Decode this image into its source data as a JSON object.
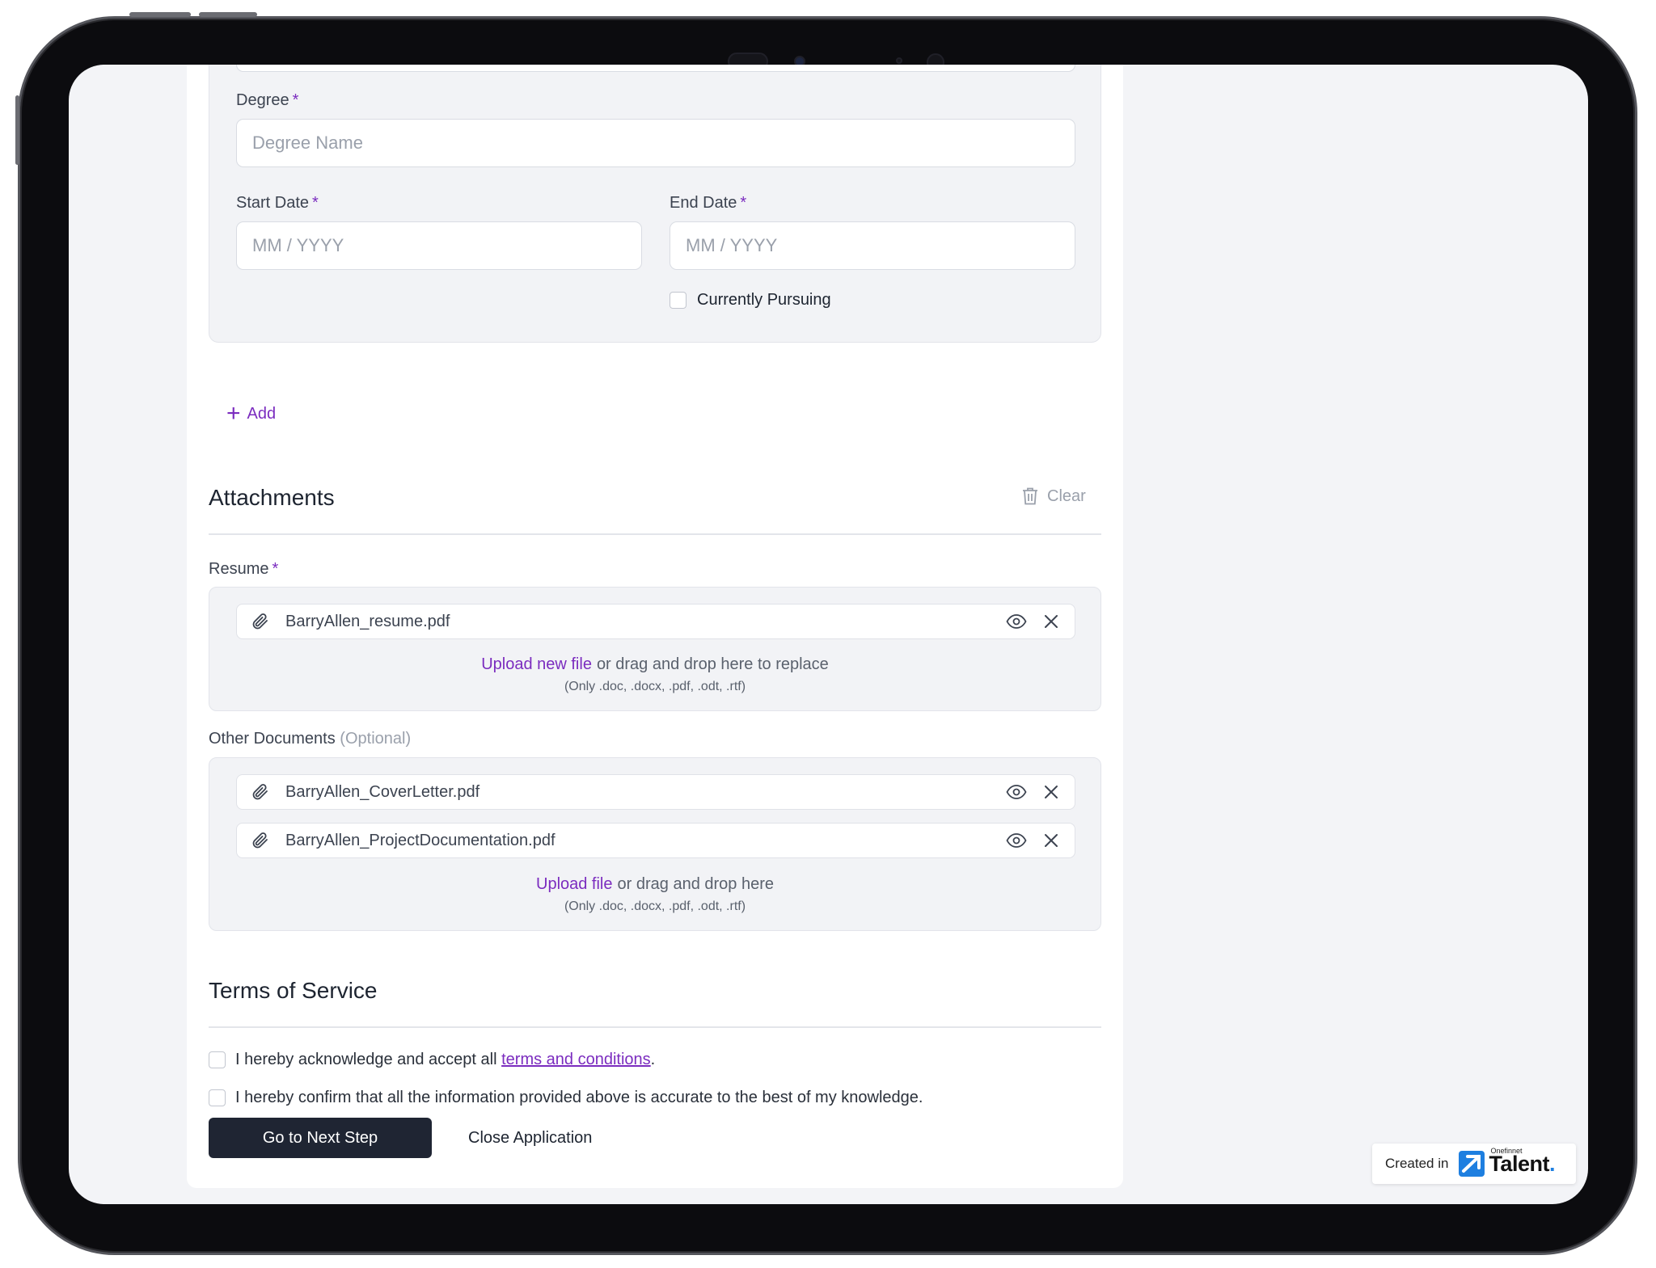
{
  "form": {
    "degree_label": "Degree",
    "degree_placeholder": "Degree Name",
    "start_date_label": "Start Date",
    "start_date_placeholder": "MM / YYYY",
    "end_date_label": "End Date",
    "end_date_placeholder": "MM / YYYY",
    "currently_pursuing_label": "Currently Pursuing",
    "required_mark": "*",
    "add_label": "Add"
  },
  "attachments": {
    "title": "Attachments",
    "clear_label": "Clear",
    "resume_label": "Resume",
    "resume_file": "BarryAllen_resume.pdf",
    "resume_upload_link": "Upload new file",
    "resume_upload_text": "or drag and drop here to replace",
    "file_hint": "(Only .doc, .docx, .pdf, .odt, .rtf)",
    "other_label": "Other Documents",
    "other_optional": "(Optional)",
    "other_files": [
      "BarryAllen_CoverLetter.pdf",
      "BarryAllen_ProjectDocumentation.pdf"
    ],
    "other_upload_link": "Upload file",
    "other_upload_text": "or drag and drop here"
  },
  "terms": {
    "title": "Terms of Service",
    "ack_prefix": "I hereby acknowledge and accept all ",
    "ack_link": "terms and conditions",
    "ack_suffix": ".",
    "confirm_text": "I hereby confirm that all the information provided above is accurate to the best of my knowledge."
  },
  "actions": {
    "next_label": "Go to Next Step",
    "close_label": "Close Application"
  },
  "badge": {
    "created_in": "Created in",
    "brand_small": "Onefinnet",
    "brand_big": "Talent",
    "brand_dot": "."
  },
  "colors": {
    "accent": "#7b2cbf",
    "primary_button": "#1f2533",
    "page_background": "#f3f4f7"
  },
  "icons": [
    "plus-icon",
    "trash-icon",
    "paperclip-icon",
    "eye-icon",
    "close-icon",
    "onefinnet-logo-icon"
  ]
}
